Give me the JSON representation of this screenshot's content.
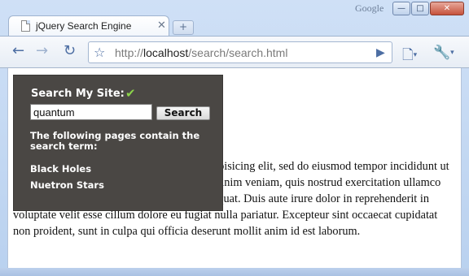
{
  "window": {
    "brand_label": "Google",
    "minimize_glyph": "—",
    "maximize_glyph": "□",
    "close_glyph": "✕"
  },
  "tabs": [
    {
      "title": "jQuery Search Engine",
      "close_glyph": "✕",
      "icon": "page-icon"
    }
  ],
  "new_tab_glyph": "+",
  "toolbar": {
    "back_glyph": "←",
    "forward_glyph": "→",
    "reload_glyph": "↻",
    "url_prefix": "http://",
    "url_host": "localhost",
    "url_path": "/search/search.html",
    "go_glyph": "▶",
    "page_menu_glyph": "🗋",
    "tools_menu_glyph": "🔧",
    "caret_glyph": "▾",
    "star_glyph": "☆"
  },
  "search_panel": {
    "title": "Search My Site:",
    "check_glyph": "✔",
    "input_value": "quantum",
    "button_label": "Search",
    "results_heading": "The following pages contain the search term:",
    "results": [
      "Black Holes",
      "Nuetron Stars"
    ]
  },
  "page_text": "Lorem ipsum dolor sit amet, consectetur adipisicing elit, sed do eiusmod tempor incididunt ut labore et dolore magna aliqua. Ut enim ad minim veniam, quis nostrud exercitation ullamco laboris nisi ut aliquip ex ea commodo consequat. Duis aute irure dolor in reprehenderit in voluptate velit esse cillum dolore eu fugiat nulla pariatur. Excepteur sint occaecat cupidatat non proident, sunt in culpa qui officia deserunt mollit anim id est laborum.",
  "colors": {
    "panel_bg": "#4a4744",
    "check": "#8bd34a",
    "link_blue": "#4d6ea3"
  }
}
